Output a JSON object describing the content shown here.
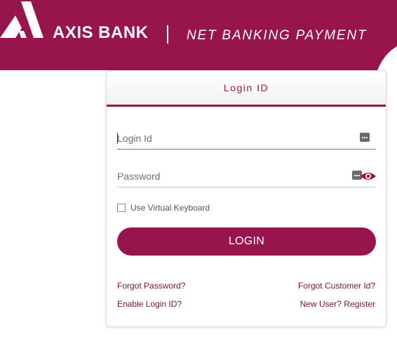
{
  "brand": {
    "name": "AXIS BANK",
    "subtitle": "NET BANKING PAYMENT",
    "color": "#97144d"
  },
  "login_card": {
    "header_title": "Login ID",
    "login_id_placeholder": "Login Id",
    "password_placeholder": "Password",
    "login_id_icon": "keyboard-icon",
    "password_icon": "eye-icon",
    "virtual_keyboard_label": "Use Virtual Keyboard",
    "virtual_keyboard_checked": false,
    "login_button_label": "LOGIN",
    "links": {
      "forgot_password": "Forgot Password?",
      "forgot_customer_id": "Forgot Customer Id?",
      "enable_login_id": "Enable Login ID?",
      "new_user_register": "New User? Register"
    }
  }
}
